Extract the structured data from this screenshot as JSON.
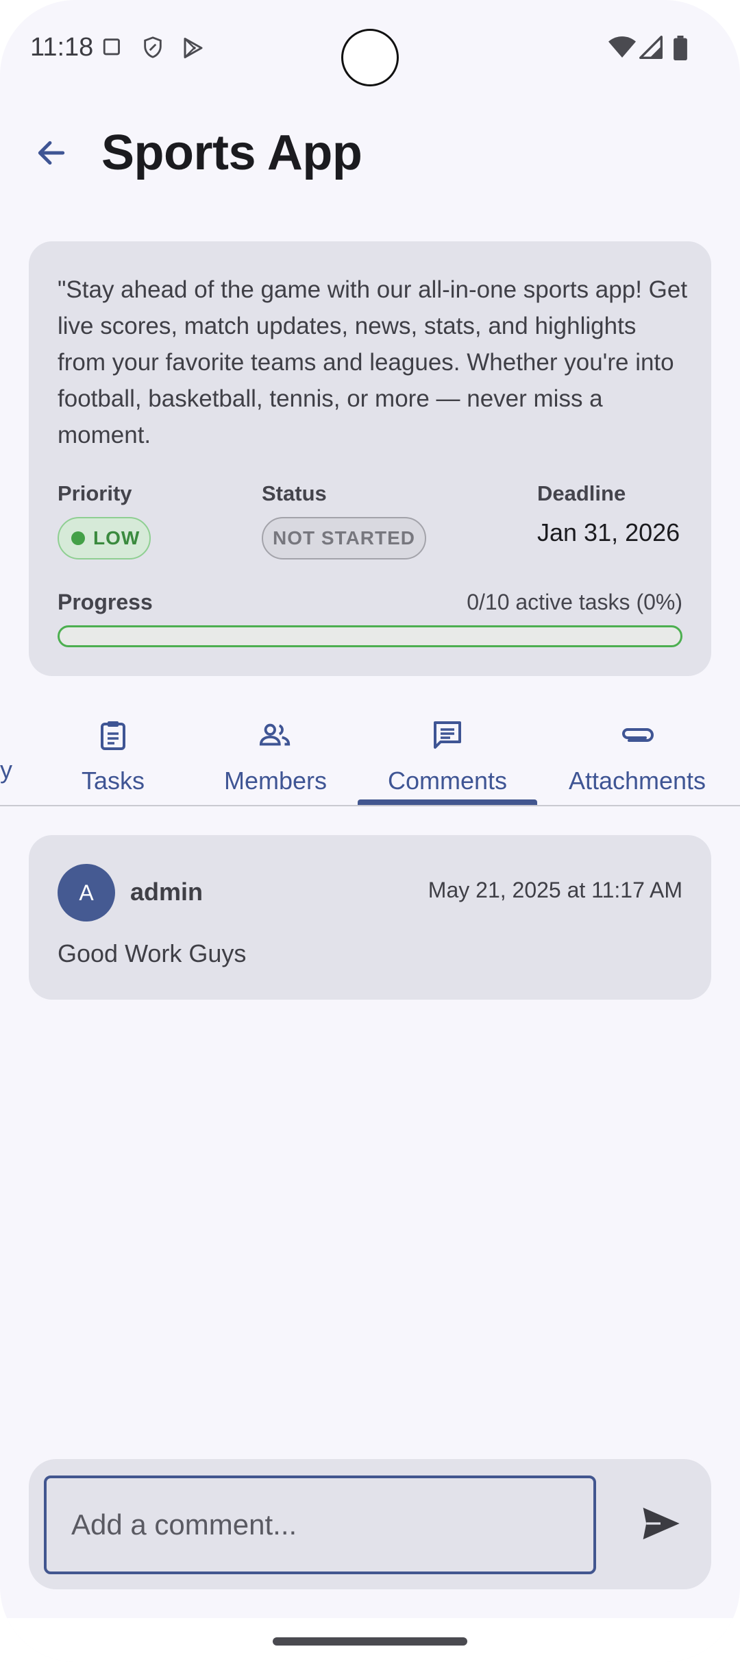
{
  "status_bar": {
    "time": "11:18",
    "left_icons": [
      "screen-icon",
      "shield-icon",
      "play-store-icon"
    ],
    "right_icons": [
      "wifi-icon",
      "signal-icon",
      "battery-icon"
    ]
  },
  "app_bar": {
    "back_icon": "arrow-back-icon",
    "title": "Sports App"
  },
  "project": {
    "description": "\"Stay ahead of the game with our all-in-one sports app! Get live scores, match updates, news, stats, and highlights from your favorite teams and leagues. Whether you're into football, basketball, tennis, or more — never miss a moment.",
    "priority_label": "Priority",
    "priority_value": "LOW",
    "status_label": "Status",
    "status_value": "NOT STARTED",
    "deadline_label": "Deadline",
    "deadline_value": "Jan 31, 2026",
    "progress_label": "Progress",
    "progress_text": "0/10 active tasks (0%)",
    "progress_fraction": 0,
    "colors": {
      "priority_low": "#43a047",
      "accent": "#42568f"
    }
  },
  "tabs": {
    "partial_left_label": "y",
    "items": [
      {
        "label": "Tasks",
        "icon": "clipboard-icon",
        "selected": false
      },
      {
        "label": "Members",
        "icon": "people-icon",
        "selected": false
      },
      {
        "label": "Comments",
        "icon": "comment-icon",
        "selected": true
      },
      {
        "label": "Attachments",
        "icon": "paperclip-icon",
        "selected": false
      }
    ]
  },
  "comments": [
    {
      "avatar_initial": "A",
      "author": "admin",
      "timestamp": "May 21, 2025 at 11:17 AM",
      "text": "Good Work Guys"
    }
  ],
  "composer": {
    "placeholder": "Add a comment...",
    "value": "",
    "send_icon": "send-icon"
  }
}
